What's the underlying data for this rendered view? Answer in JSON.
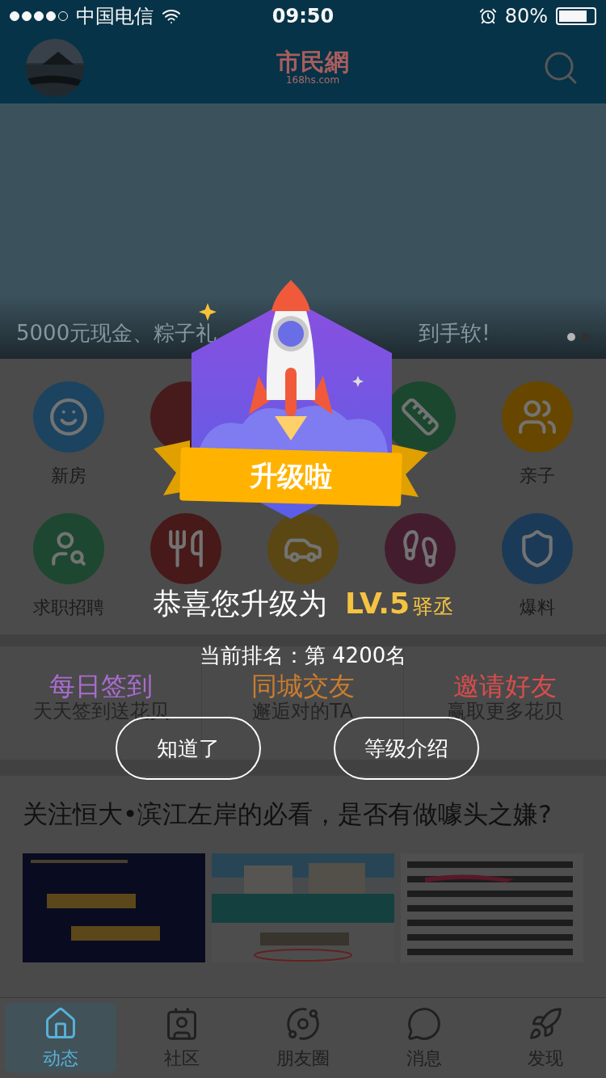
{
  "status_bar": {
    "carrier": "中国电信",
    "time": "09:50",
    "battery": "80%"
  },
  "header": {
    "logo": "市民網",
    "logo_sub": "168hs.com"
  },
  "banner": {
    "caption_left": "5000元现金、粽子礼",
    "caption_right": "到手软!",
    "dots": [
      {
        "selected": true
      },
      {
        "selected": false
      }
    ]
  },
  "shortcuts": [
    {
      "kind": "house-face",
      "label": "新房",
      "color": "#1d4664"
    },
    {
      "kind": "plain",
      "color": "#4a1c1c"
    },
    {
      "kind": "hidden"
    },
    {
      "kind": "ruler",
      "color": "#1c4a30"
    },
    {
      "kind": "family",
      "label": "亲子",
      "color": "#6b4a00"
    },
    {
      "kind": "job",
      "label": "求职招聘",
      "color": "#1e4a32"
    },
    {
      "kind": "food",
      "color": "#4a1a1a"
    },
    {
      "kind": "car",
      "color": "#5e4a14"
    },
    {
      "kind": "heel",
      "color": "#461e30"
    },
    {
      "kind": "shield",
      "label": "爆料",
      "color": "#1c3c5a"
    }
  ],
  "promo_cards": [
    {
      "title": "每日签到",
      "subtitle": "天天签到送花贝",
      "color": "#b070d8"
    },
    {
      "title": "同城交友",
      "subtitle": "邂逅对的TA",
      "color": "#d08030"
    },
    {
      "title": "邀请好友",
      "subtitle": "赢取更多花贝",
      "color": "#e05050"
    }
  ],
  "article": {
    "title": "关注恒大•滨江左岸的必看，是否有做噱头之嫌?"
  },
  "tabs": [
    {
      "label": "动态",
      "selected": true
    },
    {
      "label": "社区",
      "selected": false
    },
    {
      "label": "朋友圈",
      "selected": false
    },
    {
      "label": "消息",
      "selected": false
    },
    {
      "label": "发现",
      "selected": false
    }
  ],
  "dialog": {
    "badge_label": "升级啦",
    "message": "恭喜您升级为",
    "grade": "LV.5",
    "rank_title": "驿丞",
    "rank_line": "当前排名：第 4200名",
    "buttons": [
      "知道了",
      "等级介绍"
    ]
  }
}
